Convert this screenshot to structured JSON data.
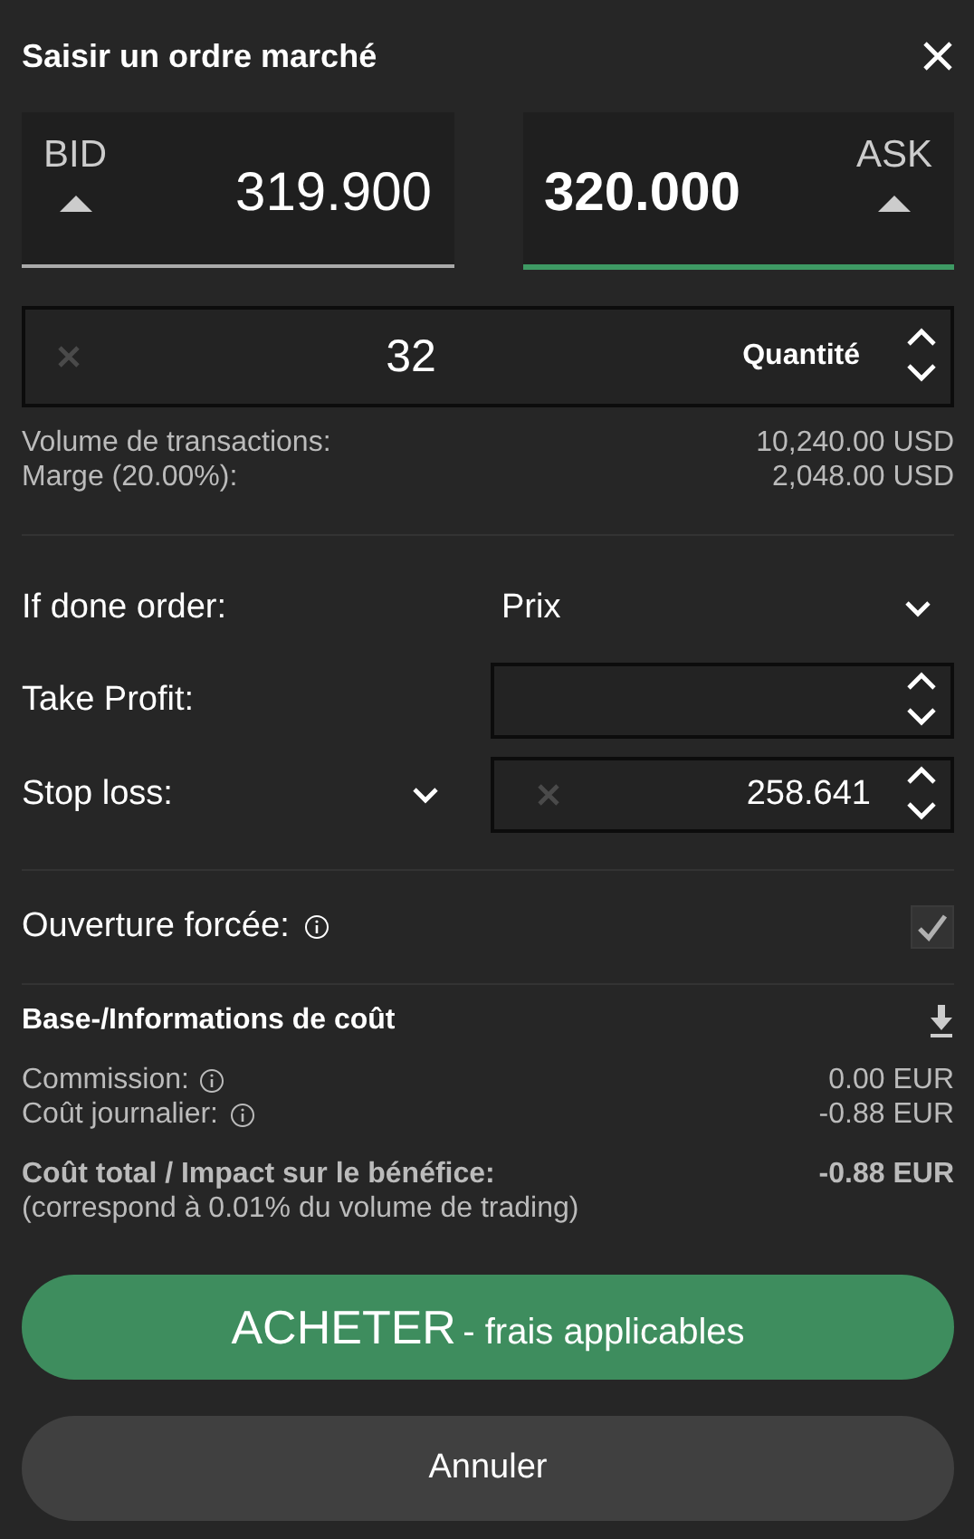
{
  "dialog": {
    "title": "Saisir un ordre marché"
  },
  "prices": [
    {
      "kind": "bid",
      "label": "BID",
      "value": "319.900",
      "selected": false
    },
    {
      "kind": "ask",
      "label": "ASK",
      "value": "320.000",
      "selected": true
    }
  ],
  "quantity": {
    "value": "32",
    "label": "Quantité"
  },
  "summary": [
    {
      "label": "Volume de transactions:",
      "value": "10,240.00 USD"
    },
    {
      "label": "Marge (20.00%):",
      "value": "2,048.00 USD"
    }
  ],
  "if_done": {
    "label": "If done order:",
    "value": "Prix"
  },
  "take_profit": {
    "label": "Take Profit:"
  },
  "stop_loss": {
    "label": "Stop loss:",
    "value": "258.641"
  },
  "forced_open": {
    "label": "Ouverture forcée:",
    "checked": true,
    "disabled": true
  },
  "costs": {
    "title": "Base-/Informations de coût",
    "items": [
      {
        "label": "Commission:",
        "value": "0.00 EUR"
      },
      {
        "label": "Coût journalier:",
        "value": "-0.88 EUR"
      }
    ],
    "total": {
      "label": "Coût total / Impact sur le bénéfice:",
      "value": "-0.88 EUR",
      "note": "(correspond à 0.01% du volume de trading)"
    }
  },
  "buy_button": {
    "label": "ACHETER",
    "suffix": "- frais applicables"
  },
  "cancel_button": {
    "label": "Annuler"
  }
}
